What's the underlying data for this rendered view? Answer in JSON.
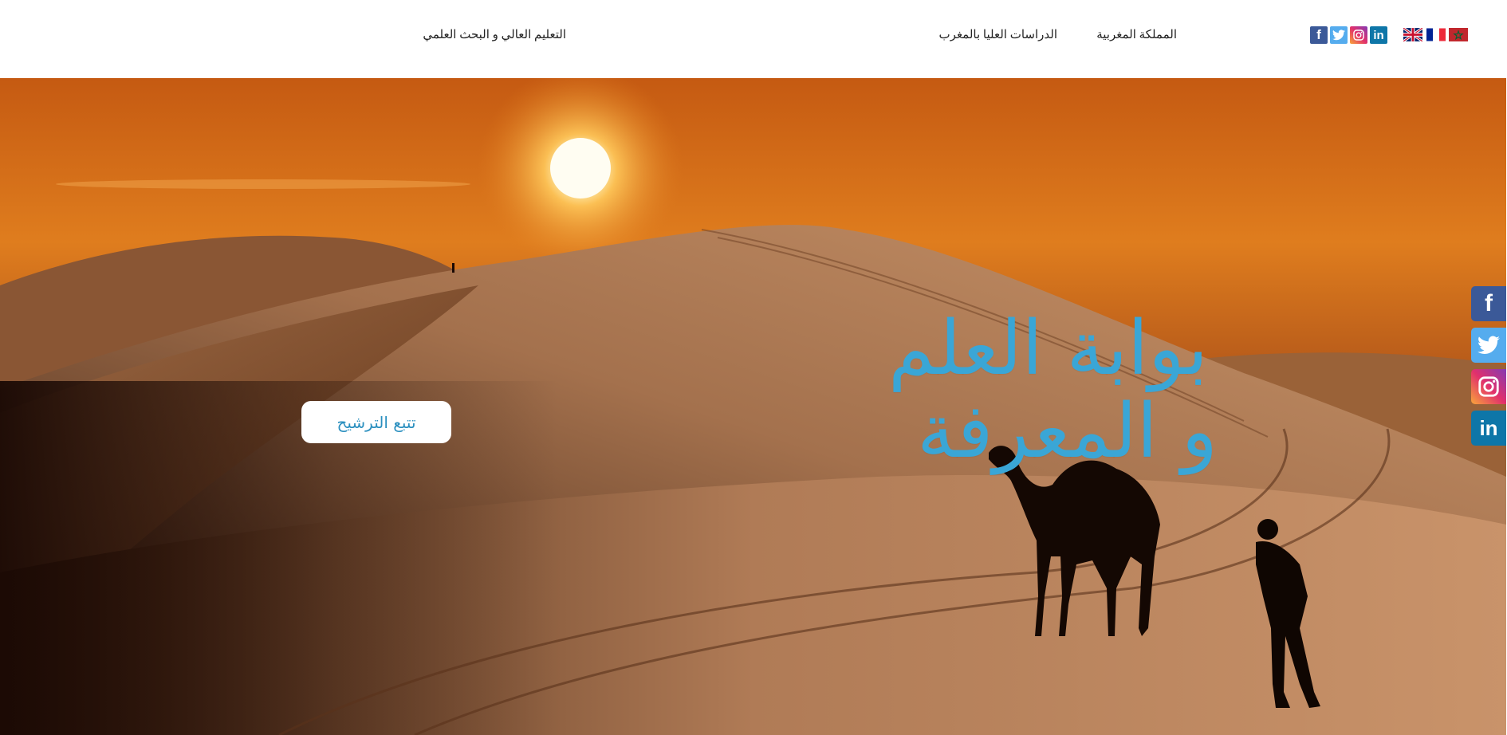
{
  "header": {
    "nav": [
      {
        "label": "المملكة المغربية"
      },
      {
        "label": "الدراسات العليا بالمغرب"
      },
      {
        "label": "التعليم العالي و البحث العلمي"
      }
    ],
    "social_icons": [
      "facebook-icon",
      "twitter-icon",
      "instagram-icon",
      "linkedin-icon"
    ],
    "languages": [
      "english-flag",
      "french-flag",
      "morocco-flag"
    ]
  },
  "hero": {
    "title_line1": "بوابة العلم",
    "title_line2": "و المعرفة",
    "track_button": "تتبع الترشيح"
  },
  "side_social": [
    "facebook-icon",
    "twitter-icon",
    "instagram-icon",
    "linkedin-icon"
  ],
  "colors": {
    "accent": "#3aa6d6",
    "facebook": "#3b5998",
    "twitter": "#55acee",
    "linkedin": "#0e76a8",
    "sky_top": "#c2570f",
    "sky_glow": "#f3a23c"
  }
}
